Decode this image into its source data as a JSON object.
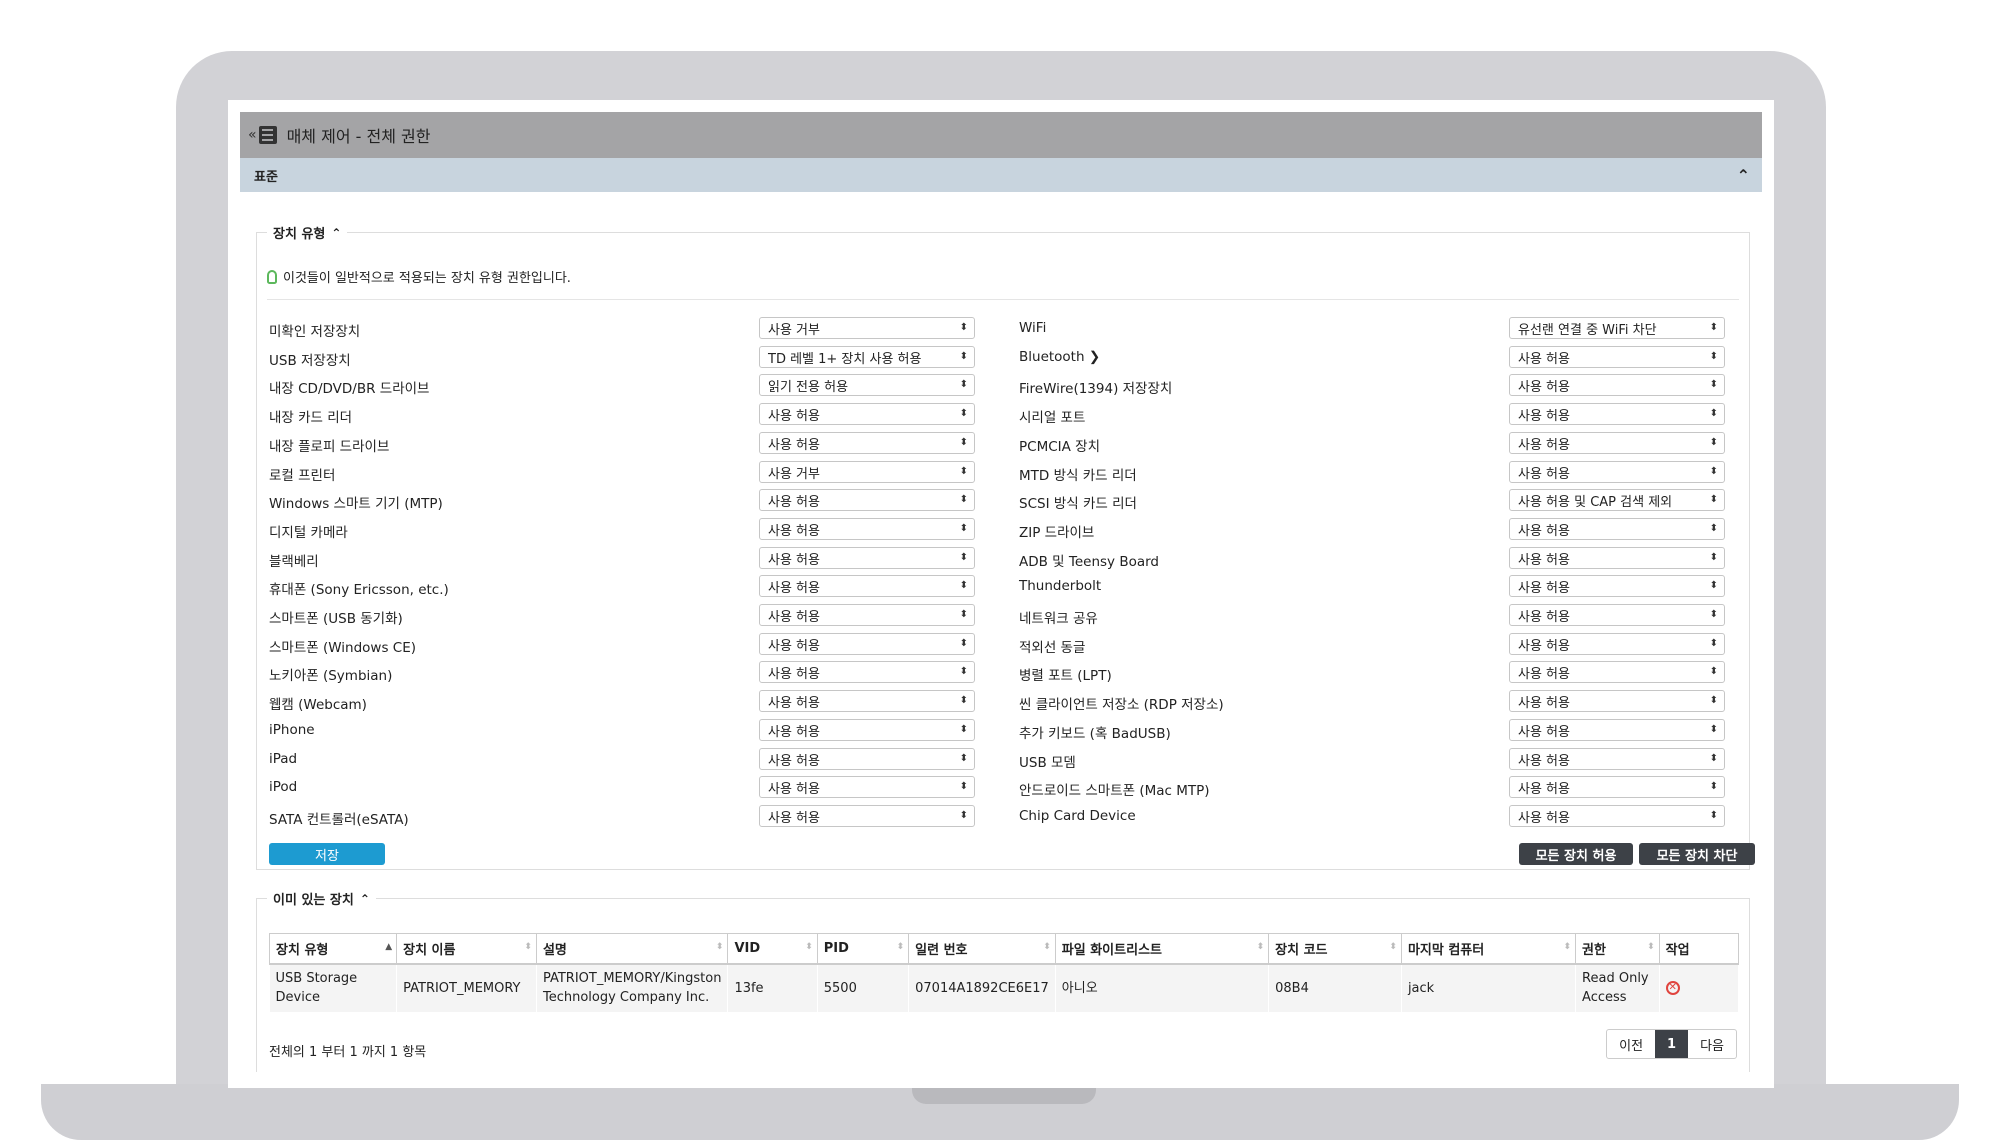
{
  "window": {
    "title": "매체 제어 - 전체 권한",
    "collapse_glyph": "«"
  },
  "section": {
    "title": "표준"
  },
  "device_types": {
    "legend": "장치 유형",
    "hint": "이것들이 일반적으로 적용되는 장치 유형 권한입니다.",
    "left": [
      {
        "label": "미확인 저장장치",
        "value": "사용 거부"
      },
      {
        "label": "USB 저장장치",
        "value": "TD 레벨 1+ 장치 사용 허용"
      },
      {
        "label": "내장 CD/DVD/BR 드라이브",
        "value": "읽기 전용 허용"
      },
      {
        "label": "내장 카드 리더",
        "value": "사용 허용"
      },
      {
        "label": "내장 플로피 드라이브",
        "value": "사용 허용"
      },
      {
        "label": "로컬 프린터",
        "value": "사용 거부"
      },
      {
        "label": "Windows 스마트 기기 (MTP)",
        "value": "사용 허용"
      },
      {
        "label": "디지털 카메라",
        "value": "사용 허용"
      },
      {
        "label": "블랙베리",
        "value": "사용 허용"
      },
      {
        "label": "휴대폰 (Sony Ericsson, etc.)",
        "value": "사용 허용"
      },
      {
        "label": "스마트폰 (USB 동기화)",
        "value": "사용 허용"
      },
      {
        "label": "스마트폰 (Windows CE)",
        "value": "사용 허용"
      },
      {
        "label": "노키아폰 (Symbian)",
        "value": "사용 허용"
      },
      {
        "label": "웹캠 (Webcam)",
        "value": "사용 허용"
      },
      {
        "label": "iPhone",
        "value": "사용 허용"
      },
      {
        "label": "iPad",
        "value": "사용 허용"
      },
      {
        "label": "iPod",
        "value": "사용 허용"
      },
      {
        "label": "SATA 컨트롤러(eSATA)",
        "value": "사용 허용"
      }
    ],
    "right": [
      {
        "label": "WiFi",
        "value": "유선랜 연결 중 WiFi 차단"
      },
      {
        "label": "Bluetooth ❯",
        "value": "사용 허용"
      },
      {
        "label": "FireWire(1394) 저장장치",
        "value": "사용 허용"
      },
      {
        "label": "시리얼 포트",
        "value": "사용 허용"
      },
      {
        "label": "PCMCIA 장치",
        "value": "사용 허용"
      },
      {
        "label": "MTD 방식 카드 리더",
        "value": "사용 허용"
      },
      {
        "label": "SCSI 방식 카드 리더",
        "value": "사용 허용 및 CAP 검색 제외"
      },
      {
        "label": "ZIP 드라이브",
        "value": "사용 허용"
      },
      {
        "label": "ADB 및 Teensy Board",
        "value": "사용 허용"
      },
      {
        "label": "Thunderbolt",
        "value": "사용 허용"
      },
      {
        "label": "네트워크 공유",
        "value": "사용 허용"
      },
      {
        "label": "적외선 동글",
        "value": "사용 허용"
      },
      {
        "label": "병렬 포트 (LPT)",
        "value": "사용 허용"
      },
      {
        "label": "씬 클라이언트 저장소 (RDP 저장소)",
        "value": "사용 허용"
      },
      {
        "label": "추가 키보드 (혹 BadUSB)",
        "value": "사용 허용"
      },
      {
        "label": "USB 모뎀",
        "value": "사용 허용"
      },
      {
        "label": "안드로이드 스마트폰 (Mac MTP)",
        "value": "사용 허용"
      },
      {
        "label": "Chip Card Device",
        "value": "사용 허용"
      }
    ],
    "save_label": "저장",
    "allow_all_label": "모든 장치 허용",
    "block_all_label": "모든 장치 차단"
  },
  "existing": {
    "legend": "이미 있는 장치",
    "columns": [
      "장치 유형",
      "장치 이름",
      "설명",
      "VID",
      "PID",
      "일련 번호",
      "파일 화이트리스트",
      "장치 코드",
      "마지막 컴퓨터",
      "권한",
      "작업"
    ],
    "rows": [
      {
        "type": "USB Storage Device",
        "name": "PATRIOT_MEMORY",
        "desc": "PATRIOT_MEMORY/Kingston Technology Company Inc.",
        "vid": "13fe",
        "pid": "5500",
        "serial": "07014A1892CE6E17",
        "whitelist": "아니오",
        "code": "08B4",
        "last_computer": "jack",
        "permission": "Read Only Access"
      }
    ],
    "info": "전체의 1 부터 1 까지 1 항목",
    "pager": {
      "prev": "이전",
      "current": "1",
      "next": "다음"
    }
  }
}
